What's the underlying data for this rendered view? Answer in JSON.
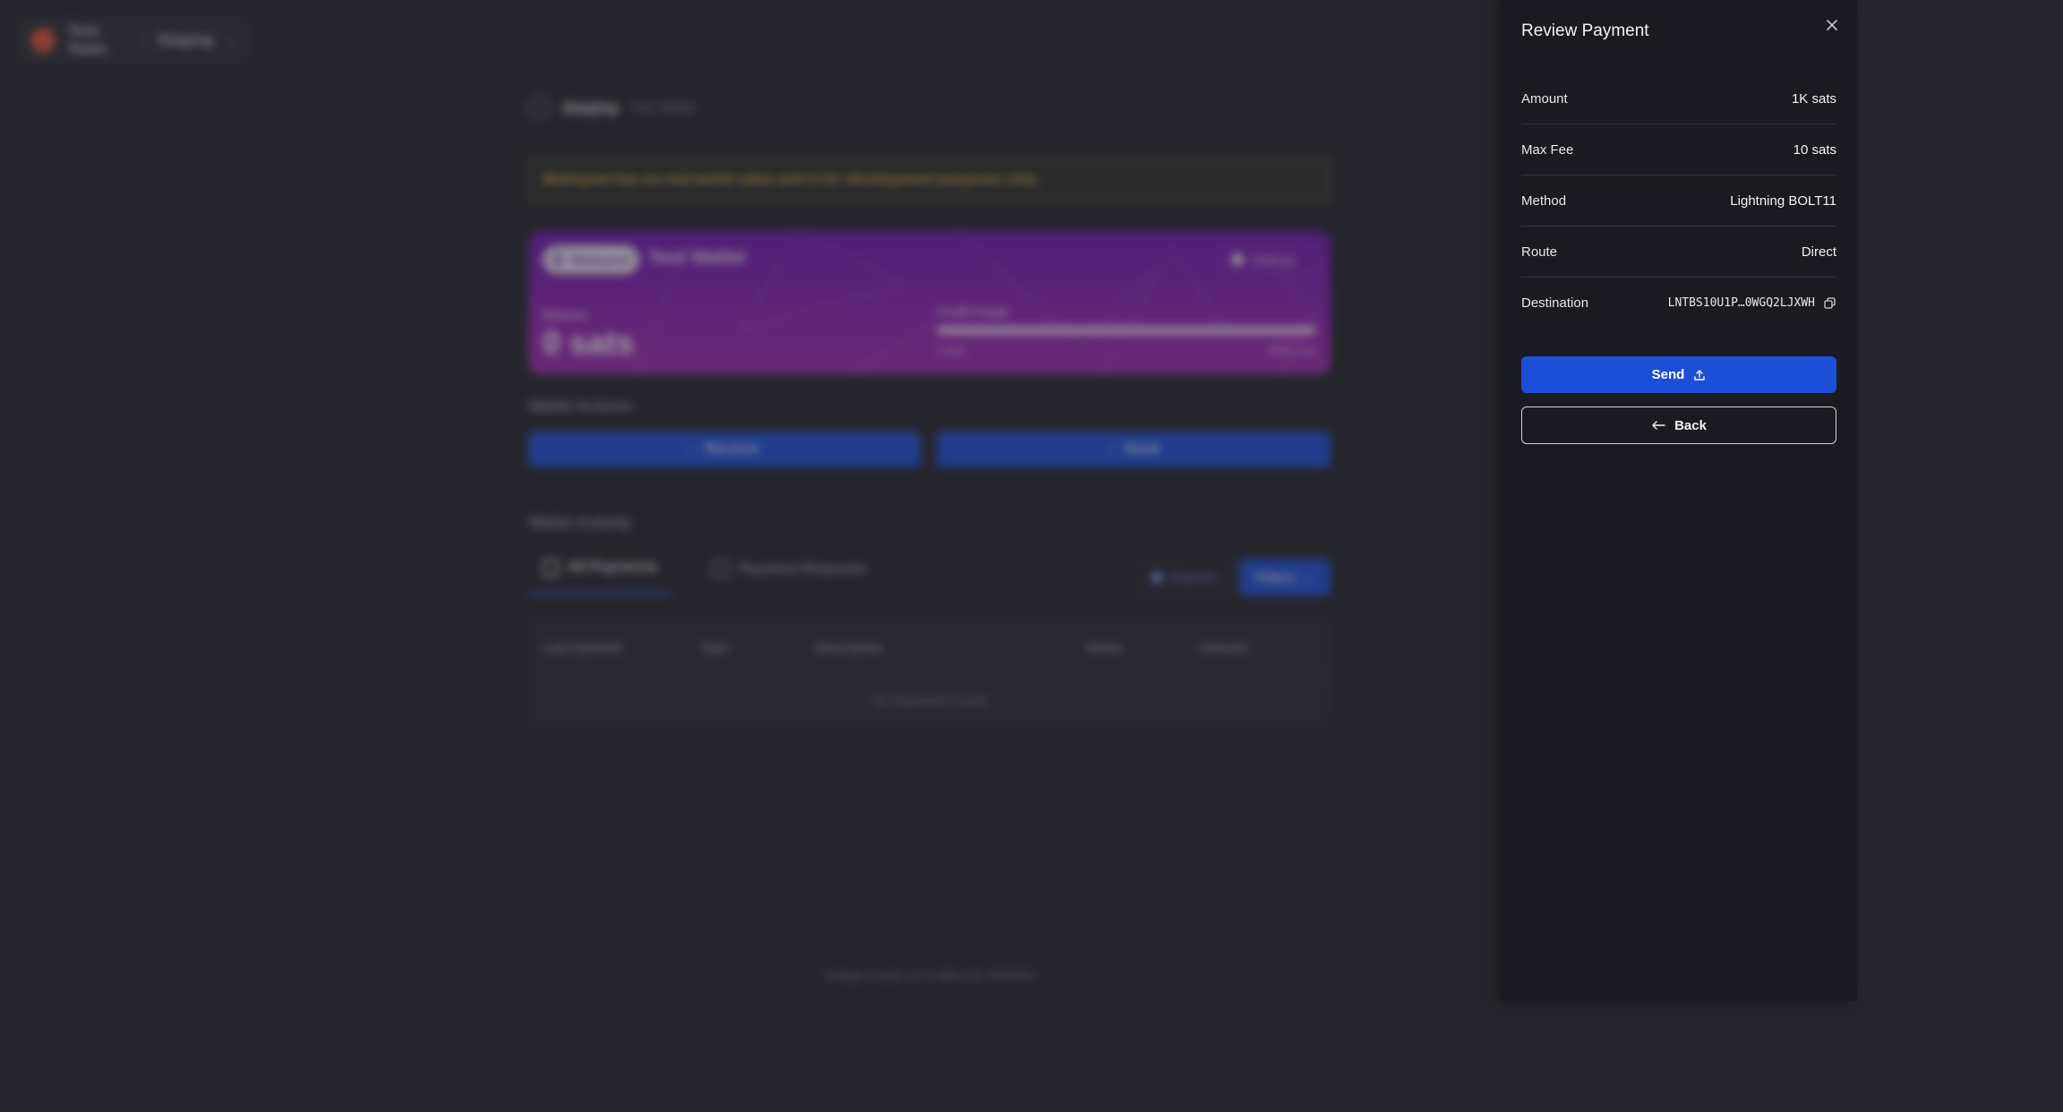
{
  "background": {
    "team": {
      "name": "Test Team",
      "separator": "/",
      "environment": "Staging"
    },
    "wallet_header": {
      "network": "Staging",
      "wallet_name": "Test Wallet"
    },
    "warning": "Mutinynet has no real-world value and is for development purposes only.",
    "wallet_card": {
      "network_pill": "Mutinynet",
      "title": "Test Wallet",
      "settings_label": "Settings",
      "balance_label": "Balance",
      "balance": "0 sats",
      "credit_label": "Credit Usage",
      "credit_min": "0 sats",
      "credit_max": "500K sats",
      "credit_usage_fraction": 1.0,
      "gradient_top": "#6f18b0",
      "gradient_bottom": "#a62bb4"
    },
    "actions_title": "Wallet Actions",
    "receive_label": "Receive",
    "send_label": "Send",
    "activity_title": "Wallet Activity",
    "tabs": [
      {
        "label": "All Payments",
        "active": true
      },
      {
        "label": "Payment Requests",
        "active": false
      }
    ],
    "reports_label": "Reports",
    "filters_label": "Filters",
    "table": {
      "columns": [
        "Last Updated",
        "Type",
        "Description",
        "Status",
        "Amount"
      ],
      "empty_text": "No Payments Found"
    },
    "footer": "Voltage Credit, LLC | NMLS ID: 0000000"
  },
  "drawer": {
    "title": "Review Payment",
    "rows": [
      {
        "label": "Amount",
        "value": "1K sats"
      },
      {
        "label": "Max Fee",
        "value": "10 sats"
      },
      {
        "label": "Method",
        "value": "Lightning BOLT11"
      },
      {
        "label": "Route",
        "value": "Direct"
      },
      {
        "label": "Destination",
        "value": "LNTBS10U1P…0WGQ2LJXWH"
      }
    ],
    "send_label": "Send",
    "back_label": "Back",
    "accent_color": "#1c4fd8"
  }
}
